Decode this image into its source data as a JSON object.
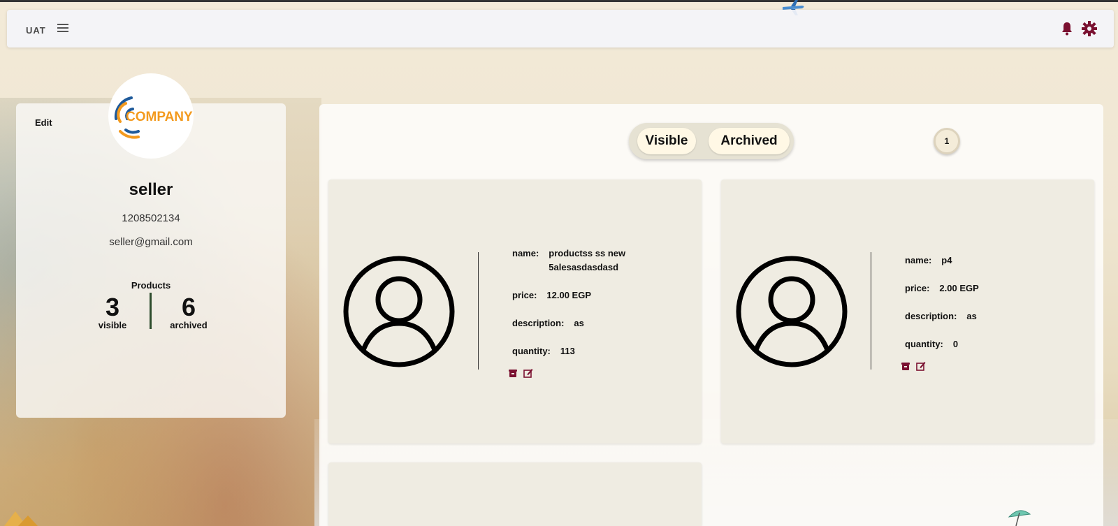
{
  "header": {
    "brand": "UAT",
    "icons": [
      "menu-icon",
      "bell-icon",
      "gear-icon"
    ]
  },
  "profile": {
    "edit_label": "Edit",
    "logo_text": "COMPANY",
    "name": "seller",
    "phone": "1208502134",
    "email": "seller@gmail.com",
    "products_label": "Products",
    "visible_count": "3",
    "visible_label": "visible",
    "archived_count": "6",
    "archived_label": "archived"
  },
  "tabs": {
    "visible_label": "Visible",
    "archived_label": "Archived"
  },
  "pagination": {
    "current_page": "1"
  },
  "products": [
    {
      "name_label": "name:",
      "name": "productss ss new 5alesasdasdasd",
      "price_label": "price:",
      "price": "12.00 EGP",
      "description_label": "description:",
      "description": "as",
      "quantity_label": "quantity:",
      "quantity": "113"
    },
    {
      "name_label": "name:",
      "name": "p4",
      "price_label": "price:",
      "price": "2.00 EGP",
      "description_label": "description:",
      "description": "as",
      "quantity_label": "quantity:",
      "quantity": "0"
    }
  ],
  "colors": {
    "accent": "#7a1030",
    "logo_orange": "#f39a1e",
    "logo_blue": "#1e5a9a",
    "card_bg": "#efece2"
  }
}
